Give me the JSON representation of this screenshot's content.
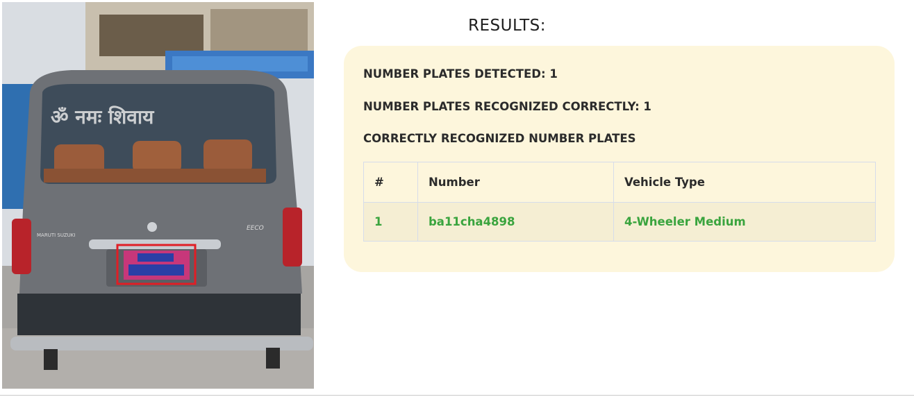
{
  "image": {
    "alt": "vehicle with detected number plate",
    "rear_badge_left": "MARUTI SUZUKI",
    "rear_badge_right": "EECO"
  },
  "results": {
    "title": "RESULTS:",
    "detected_label": "NUMBER PLATES DETECTED: 1",
    "recognized_label": "NUMBER PLATES RECOGNIZED CORRECTLY: 1",
    "section_label": "CORRECTLY RECOGNIZED NUMBER PLATES",
    "table": {
      "headers": [
        "#",
        "Number",
        "Vehicle Type"
      ],
      "rows": [
        [
          "1",
          "ba11cha4898",
          "4-Wheeler Medium"
        ]
      ]
    }
  },
  "colors": {
    "panel_bg": "#fdf6dc",
    "row_text": "#3aa43e",
    "detection_box": "#e01e25"
  }
}
